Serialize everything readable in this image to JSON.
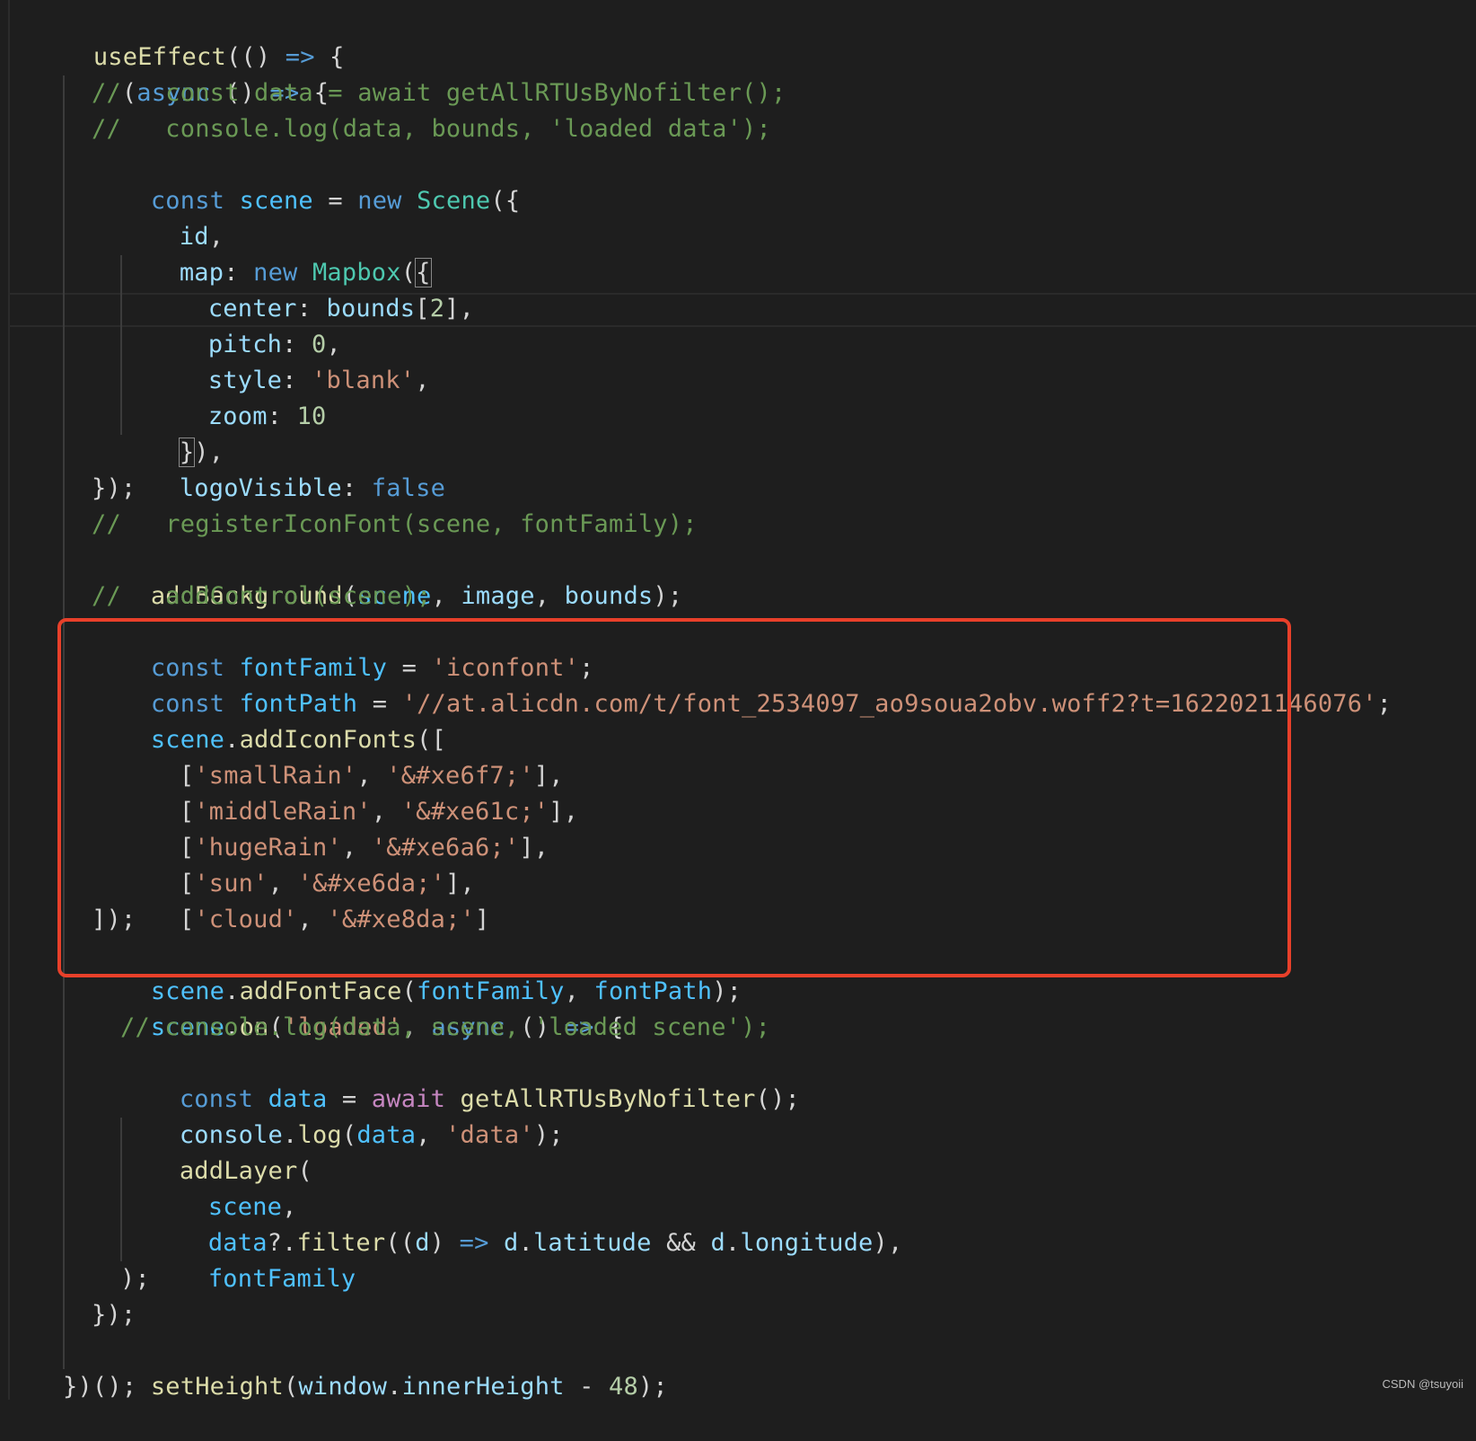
{
  "code": {
    "line01": [
      "useEffect",
      "(() ",
      "=>",
      " {"
    ],
    "line02": [
      "(",
      "async",
      " () ",
      "=>",
      " {"
    ],
    "line03": "//   const data = await getAllRTUsByNofilter();",
    "line04": "//   console.log(data, bounds, 'loaded data');",
    "line05": [
      "const",
      " ",
      "scene",
      " = ",
      "new",
      " ",
      "Scene",
      "({"
    ],
    "line06": [
      "id",
      ","
    ],
    "line07": [
      "map",
      ": ",
      "new",
      " ",
      "Mapbox",
      "(",
      "{"
    ],
    "line08": [
      "center",
      ": ",
      "bounds",
      "[",
      "2",
      "],"
    ],
    "line09": [
      "pitch",
      ": ",
      "0",
      ","
    ],
    "line10": [
      "style",
      ": ",
      "'blank'",
      ","
    ],
    "line11": [
      "zoom",
      ": ",
      "10"
    ],
    "line12": [
      "}",
      "),"
    ],
    "line13": [
      "logoVisible",
      ": ",
      "false"
    ],
    "line14": "});",
    "line15": "//   registerIconFont(scene, fontFamily);",
    "line16": [
      "addBackground",
      "(",
      "scene",
      ", ",
      "image",
      ", ",
      "bounds",
      ");"
    ],
    "line17": "//   addControl(scene);",
    "line18": [
      "const",
      " ",
      "fontFamily",
      " = ",
      "'iconfont'",
      ";"
    ],
    "line19": [
      "const",
      " ",
      "fontPath",
      " = ",
      "'//at.alicdn.com/t/font_2534097_ao9soua2obv.woff2?t=1622021146076'",
      ";"
    ],
    "line20": [
      "scene",
      ".",
      "addIconFonts",
      "(["
    ],
    "line21": [
      "[",
      "'smallRain'",
      ", ",
      "'&#xe6f7;'",
      "],"
    ],
    "line22": [
      "[",
      "'middleRain'",
      ", ",
      "'&#xe61c;'",
      "],"
    ],
    "line23": [
      "[",
      "'hugeRain'",
      ", ",
      "'&#xe6a6;'",
      "],"
    ],
    "line24": [
      "[",
      "'sun'",
      ", ",
      "'&#xe6da;'",
      "],"
    ],
    "line25": [
      "[",
      "'cloud'",
      ", ",
      "'&#xe8da;'",
      "]"
    ],
    "line26": "]);",
    "line27": [
      "scene",
      ".",
      "addFontFace",
      "(",
      "fontFamily",
      ", ",
      "fontPath",
      ");"
    ],
    "line28": [
      "scene",
      ".",
      "on",
      "(",
      "'loaded'",
      ", ",
      "async",
      " () ",
      "=>",
      " {"
    ],
    "line29": "// console.log(data, scene, 'loaded scene');",
    "line30": [
      "const",
      " ",
      "data",
      " = ",
      "await",
      " ",
      "getAllRTUsByNofilter",
      "();"
    ],
    "line31": [
      "console",
      ".",
      "log",
      "(",
      "data",
      ", ",
      "'data'",
      ");"
    ],
    "line32": [
      "addLayer",
      "("
    ],
    "line33": [
      "scene",
      ","
    ],
    "line34": [
      "data",
      "?.",
      "filter",
      "((",
      "d",
      ") ",
      "=>",
      " ",
      "d",
      ".",
      "latitude",
      " && ",
      "d",
      ".",
      "longitude",
      "),"
    ],
    "line35": [
      "fontFamily"
    ],
    "line36": ");",
    "line37": "});",
    "line38": [
      "setHeight",
      "(",
      "window",
      ".",
      "innerHeight",
      " - ",
      "48",
      ");"
    ],
    "line39": "})();"
  },
  "colors": {
    "background": "#1e1e1e",
    "keyword": "#569cd6",
    "variable": "#9cdcfe",
    "constant": "#4fc1ff",
    "function": "#dcdcaa",
    "class": "#4ec9b0",
    "string": "#ce9178",
    "number": "#b5cea8",
    "comment": "#6a9955",
    "control": "#c586c0",
    "highlight_box": "#e8402a"
  },
  "watermark": "CSDN @tsuyoii"
}
